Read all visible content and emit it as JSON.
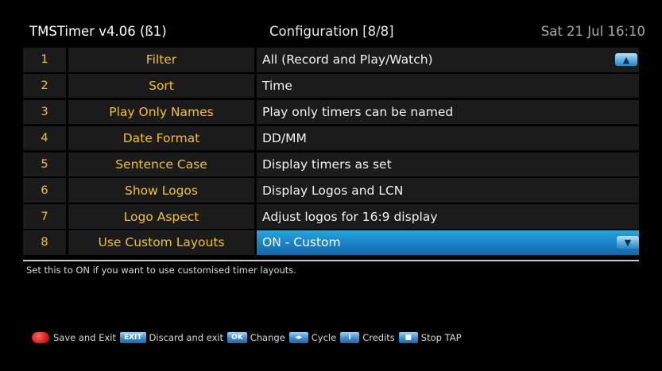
{
  "header": {
    "app_title": "TMSTimer v4.06 (ß1)",
    "screen_title": "Configuration [8/8]",
    "datetime": "Sat 21 Jul 16:10"
  },
  "rows": [
    {
      "num": "1",
      "label": "Filter",
      "value": "All (Record and Play/Watch)"
    },
    {
      "num": "2",
      "label": "Sort",
      "value": "Time"
    },
    {
      "num": "3",
      "label": "Play Only Names",
      "value": "Play only timers can be named"
    },
    {
      "num": "4",
      "label": "Date Format",
      "value": "DD/MM"
    },
    {
      "num": "5",
      "label": "Sentence Case",
      "value": "Display timers as set"
    },
    {
      "num": "6",
      "label": "Show Logos",
      "value": "Display Logos and LCN"
    },
    {
      "num": "7",
      "label": "Logo Aspect",
      "value": "Adjust logos for 16:9 display"
    },
    {
      "num": "8",
      "label": "Use Custom Layouts",
      "value": "ON - Custom"
    }
  ],
  "selected_row": 8,
  "icons": {
    "scroll_up": "up-arrow-icon",
    "scroll_down": "down-arrow-icon"
  },
  "help_text": "Set this to ON if you want to use customised timer layouts.",
  "footer": {
    "save_exit": "Save and Exit",
    "exit_key": "EXIT",
    "discard_exit": "Discard and exit",
    "ok_key": "OK",
    "change": "Change",
    "cycle_key_glyph": "◂▸",
    "cycle": "Cycle",
    "credits_key_glyph": "i",
    "credits": "Credits",
    "stop_key_glyph": "■",
    "stop_tap": "Stop TAP"
  },
  "colors": {
    "label_yellow": "#f1c22a",
    "selected_blue": "#1a7fc7",
    "cell_bg": "#1b1b1b",
    "background": "#000000"
  }
}
